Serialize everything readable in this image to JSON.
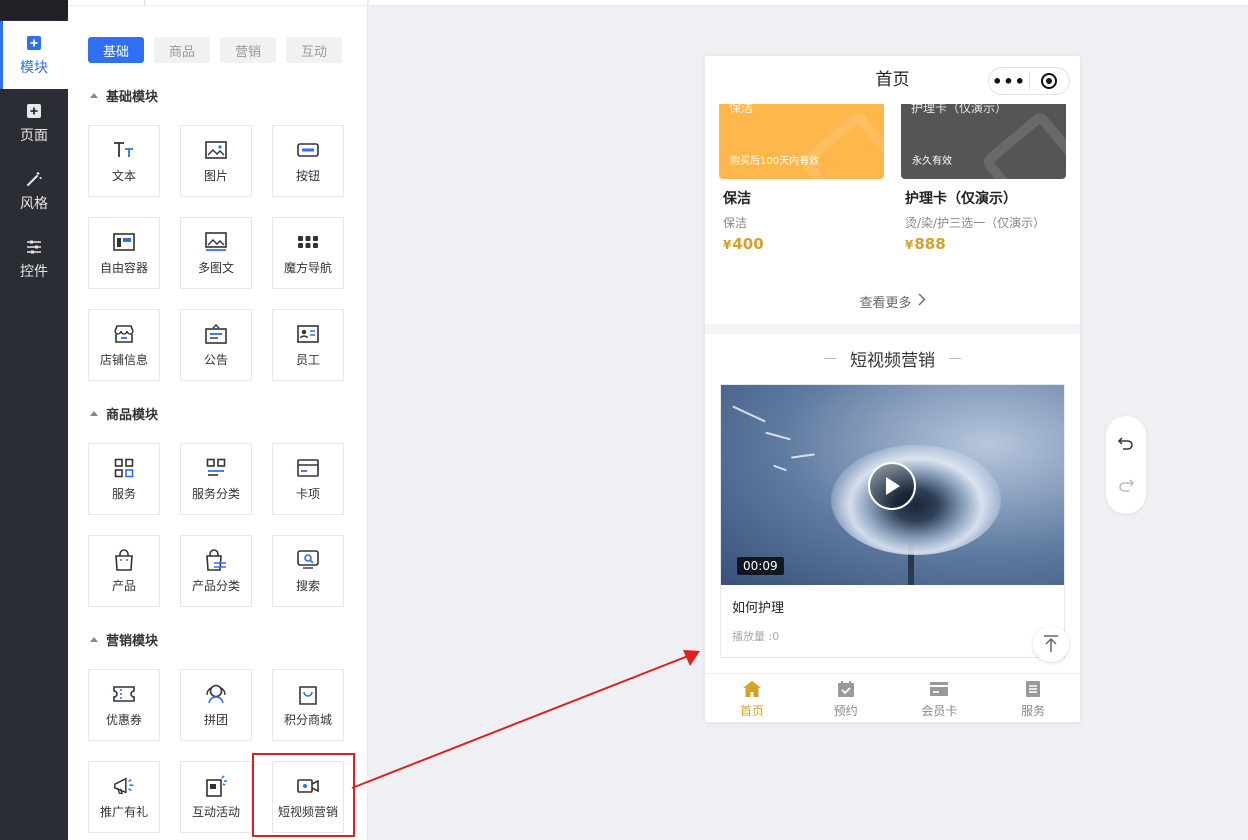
{
  "rail": {
    "items": [
      {
        "label": "模块",
        "icon": "plus-square-icon",
        "active": true
      },
      {
        "label": "页面",
        "icon": "page-plus-icon"
      },
      {
        "label": "风格",
        "icon": "magic-wand-icon"
      },
      {
        "label": "控件",
        "icon": "sliders-icon"
      }
    ]
  },
  "panel": {
    "tabs": [
      {
        "label": "基础",
        "active": true
      },
      {
        "label": "商品"
      },
      {
        "label": "营销"
      },
      {
        "label": "互动"
      }
    ],
    "sections": [
      {
        "title": "基础模块",
        "items": [
          "文本",
          "图片",
          "按钮",
          "自由容器",
          "多图文",
          "魔方导航",
          "店铺信息",
          "公告",
          "员工"
        ]
      },
      {
        "title": "商品模块",
        "items": [
          "服务",
          "服务分类",
          "卡项",
          "产品",
          "产品分类",
          "搜索"
        ]
      },
      {
        "title": "营销模块",
        "items": [
          "优惠券",
          "拼团",
          "积分商城",
          "推广有礼",
          "互动活动",
          "短视频营销"
        ]
      }
    ],
    "highlighted_item": "短视频营销"
  },
  "phone": {
    "title": "首页",
    "capsule_menu": "•••",
    "cards": [
      {
        "banner_title": "保洁",
        "banner_note": "购买后100天内有效",
        "name": "保洁",
        "desc": "保洁",
        "price": "400",
        "currency": "¥",
        "color": "#ffb64a"
      },
      {
        "banner_title": "护理卡（仅演示）",
        "banner_note": "永久有效",
        "name": "护理卡（仅演示）",
        "desc": "烫/染/护三选一（仅演示）",
        "price": "888",
        "currency": "¥",
        "color": "#555555"
      }
    ],
    "more_label": "查看更多",
    "short_video": {
      "section_title": "短视频营销",
      "duration": "00:09",
      "name": "如何护理",
      "plays": "播放量 :0"
    },
    "tabbar": [
      {
        "label": "首页",
        "icon": "home-icon",
        "active": true
      },
      {
        "label": "预约",
        "icon": "calendar-check-icon"
      },
      {
        "label": "会员卡",
        "icon": "member-card-icon"
      },
      {
        "label": "服务",
        "icon": "service-list-icon"
      }
    ]
  },
  "colors": {
    "accent": "#2f6ff1",
    "price": "#d4a12b",
    "highlight": "#e02020",
    "rail": "#2a2d33"
  }
}
